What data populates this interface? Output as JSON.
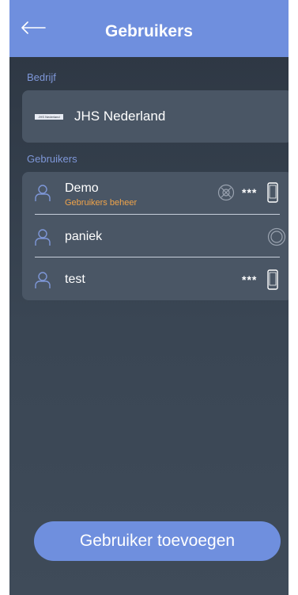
{
  "header": {
    "title": "Gebruikers",
    "back_icon": "arrow-left-icon"
  },
  "company_section": {
    "label": "Bedrijf",
    "company": {
      "name": "JHS Nederland",
      "logo_text": "JHS Nederland"
    }
  },
  "users_section": {
    "label": "Gebruikers",
    "users": [
      {
        "name": "Demo",
        "role": "Gebruikers beheer",
        "icons": [
          "no-alarm-icon",
          "password-stars-icon",
          "mobile-phone-icon"
        ],
        "password_mask": "***"
      },
      {
        "name": "paniek",
        "role": "",
        "icons": [
          "panic-ring-icon"
        ]
      },
      {
        "name": "test",
        "role": "",
        "icons": [
          "password-stars-icon",
          "mobile-phone-icon"
        ],
        "password_mask": "***"
      }
    ]
  },
  "add_button": {
    "label": "Gebruiker toevoegen"
  },
  "colors": {
    "header": "#6f8fde",
    "background": "#2c3541",
    "card": "#4a5665",
    "section_label": "#7e97d8",
    "role_text": "#f0a44a"
  }
}
